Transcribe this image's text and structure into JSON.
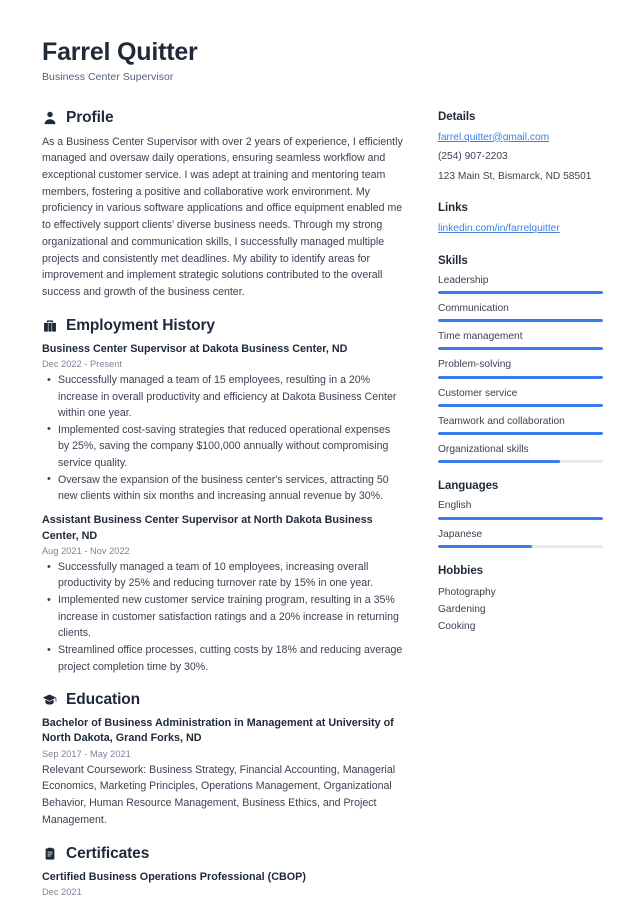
{
  "accent_color": "#3a7ced",
  "link_color": "#3f7fe0",
  "text_color": "#3b4252",
  "heading_color": "#1f2937",
  "header": {
    "name": "Farrel Quitter",
    "title": "Business Center Supervisor"
  },
  "main": {
    "profile": {
      "icon": "person-icon",
      "heading": "Profile",
      "text": "As a Business Center Supervisor with over 2 years of experience, I efficiently managed and oversaw daily operations, ensuring seamless workflow and exceptional customer service. I was adept at training and mentoring team members, fostering a positive and collaborative work environment. My proficiency in various software applications and office equipment enabled me to effectively support clients' diverse business needs. Through my strong organizational and communication skills, I successfully managed multiple projects and consistently met deadlines. My ability to identify areas for improvement and implement strategic solutions contributed to the overall success and growth of the business center."
    },
    "employment": {
      "icon": "briefcase-icon",
      "heading": "Employment History",
      "entries": [
        {
          "title": "Business Center Supervisor at Dakota Business Center, ND",
          "date": "Dec 2022 - Present",
          "bullets": [
            "Successfully managed a team of 15 employees, resulting in a 20% increase in overall productivity and efficiency at Dakota Business Center within one year.",
            "Implemented cost-saving strategies that reduced operational expenses by 25%, saving the company $100,000 annually without compromising service quality.",
            "Oversaw the expansion of the business center's services, attracting 50 new clients within six months and increasing annual revenue by 30%."
          ]
        },
        {
          "title": "Assistant Business Center Supervisor at North Dakota Business Center, ND",
          "date": "Aug 2021 - Nov 2022",
          "bullets": [
            "Successfully managed a team of 10 employees, increasing overall productivity by 25% and reducing turnover rate by 15% in one year.",
            "Implemented new customer service training program, resulting in a 35% increase in customer satisfaction ratings and a 20% increase in returning clients.",
            "Streamlined office processes, cutting costs by 18% and reducing average project completion time by 30%."
          ]
        }
      ]
    },
    "education": {
      "icon": "graduation-cap-icon",
      "heading": "Education",
      "entries": [
        {
          "title": "Bachelor of Business Administration in Management at University of North Dakota, Grand Forks, ND",
          "date": "Sep 2017 - May 2021",
          "description": "Relevant Coursework: Business Strategy, Financial Accounting, Managerial Economics, Marketing Principles, Operations Management, Organizational Behavior, Human Resource Management, Business Ethics, and Project Management."
        }
      ]
    },
    "certificates": {
      "icon": "certificate-icon",
      "heading": "Certificates",
      "entries": [
        {
          "title": "Certified Business Operations Professional (CBOP)",
          "date": "Dec 2021"
        }
      ]
    }
  },
  "sidebar": {
    "details": {
      "heading": "Details",
      "email": "farrel.quitter@gmail.com",
      "phone": "(254) 907-2203",
      "address": "123 Main St, Bismarck, ND 58501"
    },
    "links": {
      "heading": "Links",
      "items": [
        {
          "label": "linkedin.com/in/farrelquitter"
        }
      ]
    },
    "skills": {
      "heading": "Skills",
      "items": [
        {
          "label": "Leadership",
          "level": 100
        },
        {
          "label": "Communication",
          "level": 100
        },
        {
          "label": "Time management",
          "level": 100
        },
        {
          "label": "Problem-solving",
          "level": 100
        },
        {
          "label": "Customer service",
          "level": 100
        },
        {
          "label": "Teamwork and collaboration",
          "level": 100
        },
        {
          "label": "Organizational skills",
          "level": 74
        }
      ]
    },
    "languages": {
      "heading": "Languages",
      "items": [
        {
          "label": "English",
          "level": 100
        },
        {
          "label": "Japanese",
          "level": 57
        }
      ]
    },
    "hobbies": {
      "heading": "Hobbies",
      "items": [
        "Photography",
        "Gardening",
        "Cooking"
      ]
    }
  }
}
